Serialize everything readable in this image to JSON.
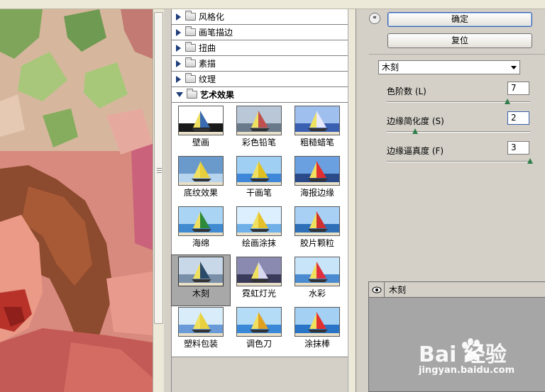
{
  "gallery": {
    "categories": [
      {
        "label": "风格化",
        "expanded": false
      },
      {
        "label": "画笔描边",
        "expanded": false
      },
      {
        "label": "扭曲",
        "expanded": false
      },
      {
        "label": "素描",
        "expanded": false
      },
      {
        "label": "纹理",
        "expanded": false
      },
      {
        "label": "艺术效果",
        "expanded": true
      }
    ],
    "filters": [
      {
        "label": "壁画"
      },
      {
        "label": "彩色铅笔"
      },
      {
        "label": "粗糙蜡笔"
      },
      {
        "label": "底纹效果"
      },
      {
        "label": "干画笔"
      },
      {
        "label": "海报边缘"
      },
      {
        "label": "海绵"
      },
      {
        "label": "绘画涂抹"
      },
      {
        "label": "胶片颗粒"
      },
      {
        "label": "木刻",
        "selected": true
      },
      {
        "label": "霓虹灯光"
      },
      {
        "label": "水彩"
      },
      {
        "label": "塑料包装"
      },
      {
        "label": "调色刀"
      },
      {
        "label": "涂抹棒"
      }
    ]
  },
  "panel": {
    "ok_label": "确定",
    "reset_label": "复位",
    "selected_filter": "木刻",
    "params": [
      {
        "label": "色阶数 (L)",
        "value": "7",
        "level": 0.84
      },
      {
        "label": "边缘简化度 (S)",
        "value": "2",
        "level": 0.2
      },
      {
        "label": "边缘逼真度 (F)",
        "value": "3",
        "level": 1.0
      }
    ],
    "layer_name": "木刻"
  },
  "watermark": {
    "brand": "Bai  经验",
    "url": "jingyan.baidu.com"
  }
}
